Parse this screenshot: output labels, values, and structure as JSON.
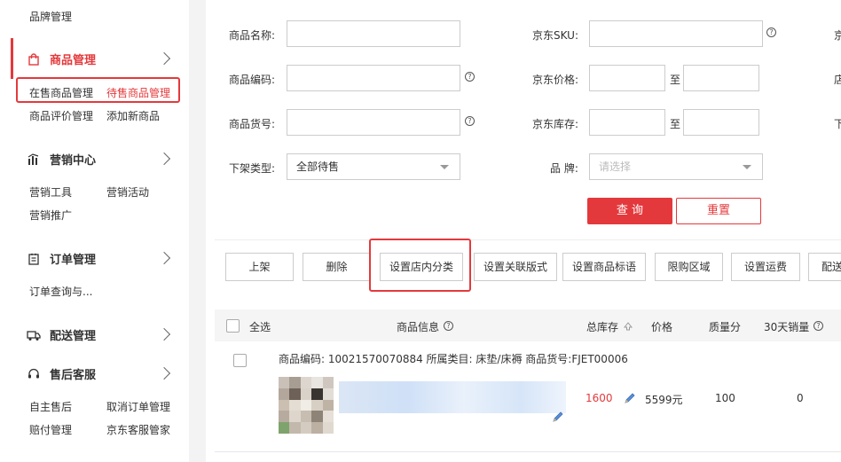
{
  "sidebar": {
    "top_item": "品牌管理",
    "groups": [
      {
        "title": "商品管理",
        "icon": "shopping-bag-icon",
        "active": true,
        "items": [
          "在售商品管理",
          "待售商品管理",
          "商品评价管理",
          "添加新商品"
        ]
      },
      {
        "title": "营销中心",
        "icon": "marketing-icon",
        "items": [
          "营销工具",
          "营销活动",
          "营销推广"
        ]
      },
      {
        "title": "订单管理",
        "icon": "order-icon",
        "items": [
          "订单查询与..."
        ]
      },
      {
        "title": "配送管理",
        "icon": "truck-icon",
        "items": []
      },
      {
        "title": "售后客服",
        "icon": "headset-icon",
        "items": [
          "自主售后",
          "取消订单管理",
          "赔付管理",
          "京东客服管家"
        ]
      }
    ]
  },
  "filters": {
    "product_name_label": "商品名称:",
    "jd_sku_label": "京东SKU:",
    "product_code_label": "商品编码:",
    "jd_price_label": "京东价格:",
    "product_no_label": "商品货号:",
    "jd_stock_label": "京东库存:",
    "to_label": "至",
    "delist_type_label": "下架类型:",
    "delist_type_value": "全部待售",
    "brand_label": "品  牌:",
    "brand_placeholder": "请选择",
    "right_cut_1": "京",
    "right_cut_2": "店",
    "right_cut_3": "下",
    "query_button": "查 询",
    "reset_button": "重置"
  },
  "toolbar": {
    "buttons": [
      "上架",
      "删除",
      "设置店内分类",
      "设置关联版式",
      "设置商品标语",
      "限购区域",
      "设置运费",
      "配送"
    ]
  },
  "table": {
    "headers": {
      "select_all": "全选",
      "product_info": "商品信息",
      "total_stock": "总库存",
      "price": "价格",
      "quality_score": "质量分",
      "sales_30d": "30天销量"
    },
    "rows": [
      {
        "meta": "商品编码: 10021570070884 所属类目: 床垫/床褥 商品货号:FJET00006",
        "stock": "1600",
        "price": "5599元",
        "quality": "100",
        "sales": "0"
      }
    ]
  },
  "colors": {
    "accent": "#e4393c"
  }
}
